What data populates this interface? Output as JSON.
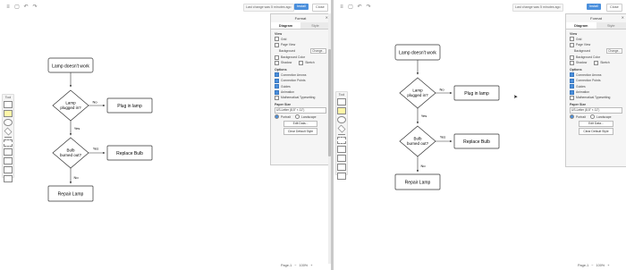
{
  "toolbar": {
    "undo_icon": "undo-icon",
    "redo_icon": "redo-icon",
    "notice_left": "Last change was 5 minutes ago",
    "notice_right": "Last change was 5 minutes ago",
    "install_label": "Install",
    "close_label": "Close"
  },
  "toolbox": {
    "title": "Tool"
  },
  "diagram": {
    "start": "Lamp doesn't work",
    "decision1_line1": "Lamp",
    "decision1_line2": "plugged in?",
    "decision2_line1": "Bulb",
    "decision2_line2": "burned out?",
    "action1": "Plug in lamp",
    "action2": "Replace Bulb",
    "end": "Repair Lamp",
    "label_no": "No",
    "label_yes": "Yes"
  },
  "format_panel": {
    "title": "Format",
    "tabs": [
      "Diagram",
      "Style"
    ],
    "view_heading": "View",
    "grid": "Grid",
    "page_view": "Page View",
    "background": "Background",
    "change_label": "Change...",
    "background_color": "Background Color",
    "shadow": "Shadow",
    "sketch": "Sketch",
    "options_heading": "Options",
    "connection_arrows": "Connection Arrows",
    "connection_points": "Connection Points",
    "guides": "Guides",
    "animation": "Animation",
    "math_typesetting": "Mathematical Typesetting",
    "paper_size_heading": "Paper Size",
    "paper_size_value": "US-Letter (8,5\" × 11\")",
    "portrait": "Portrait",
    "landscape": "Landscape",
    "edit_data": "Edit Data...",
    "clear_default_style": "Clear Default Style"
  },
  "pagebar": {
    "page": "Page-1",
    "zoom": "100%"
  },
  "colors": {
    "accent": "#4a8fdc",
    "panel_bg": "#f5f5f5",
    "divider": "#c9c9c9"
  }
}
